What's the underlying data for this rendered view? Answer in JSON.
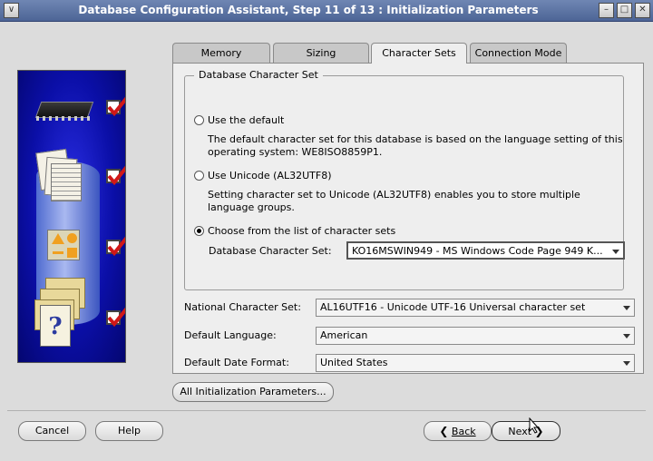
{
  "window": {
    "title": "Database Configuration Assistant, Step 11 of 13 : Initialization Parameters",
    "controls": {
      "menu": "∨",
      "minimize": "–",
      "maximize": "□",
      "close": "✕"
    }
  },
  "side_panel": {
    "icons": [
      "chip-icon",
      "documents-icon",
      "shapes-icon",
      "help-folder-icon"
    ],
    "help_glyph": "?"
  },
  "tabs": [
    {
      "label": "Memory",
      "active": false
    },
    {
      "label": "Sizing",
      "active": false
    },
    {
      "label": "Character Sets",
      "active": true
    },
    {
      "label": "Connection Mode",
      "active": false
    }
  ],
  "charset_group": {
    "title": "Database Character Set",
    "options": [
      {
        "label": "Use the default",
        "selected": false,
        "description": "The default character set for this database is based on the language setting of this operating system: WE8ISO8859P1."
      },
      {
        "label": "Use Unicode (AL32UTF8)",
        "selected": false,
        "description": "Setting character set to Unicode (AL32UTF8) enables you to store multiple language groups."
      },
      {
        "label": "Choose from the list of character sets",
        "selected": true
      }
    ],
    "db_charset_label": "Database Character Set:",
    "db_charset_value": "KO16MSWIN949 - MS Windows Code Page 949 K..."
  },
  "fields": {
    "national_label": "National Character Set:",
    "national_value": "AL16UTF16 - Unicode UTF-16 Universal character set",
    "language_label": "Default Language:",
    "language_value": "American",
    "date_format_label": "Default Date Format:",
    "date_format_value": "United States"
  },
  "buttons": {
    "all_params": "All Initialization Parameters...",
    "cancel": "Cancel",
    "help": "Help",
    "back": "Back",
    "next": "Next",
    "back_glyph": "❮",
    "next_glyph": "❯"
  },
  "colors": {
    "title_bar": "#5a72a6",
    "side_panel": "#0b0fa8",
    "check_mark": "#d01818"
  }
}
